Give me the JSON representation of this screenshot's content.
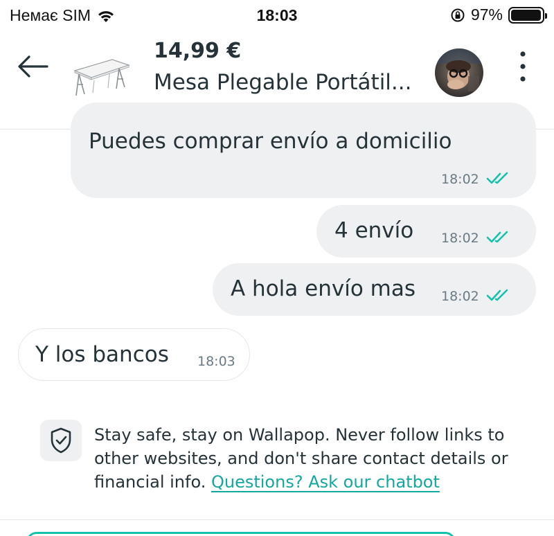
{
  "status_bar": {
    "carrier": "Немає SIM",
    "time": "18:03",
    "battery_percent": "97%",
    "battery_level": 0.97
  },
  "header": {
    "price": "14,99 €",
    "item_title": "Mesa Plegable Portátil..."
  },
  "messages": [
    {
      "text": "Puedes comprar envío a domicilio",
      "time": "18:02",
      "direction": "outgoing",
      "read": true
    },
    {
      "text": "4 envío",
      "time": "18:02",
      "direction": "outgoing",
      "read": true
    },
    {
      "text": "A hola envío mas",
      "time": "18:02",
      "direction": "outgoing",
      "read": true
    },
    {
      "text": "Y los bancos",
      "time": "18:03",
      "direction": "incoming"
    }
  ],
  "safety_notice": {
    "text": "Stay safe, stay on Wallapop. Never follow links to other websites, and don't share contact details or financial info.",
    "link": "Questions? Ask our chatbot"
  },
  "colors": {
    "accent": "#13c1ac",
    "link": "#13a89e",
    "bubble_outgoing": "#eef0f2",
    "text": "#253238",
    "meta": "#6c7a83"
  },
  "icons": [
    "wifi-icon",
    "rotation-lock-icon",
    "battery-icon",
    "back-arrow-icon",
    "more-vertical-icon",
    "double-check-icon",
    "shield-check-icon"
  ]
}
